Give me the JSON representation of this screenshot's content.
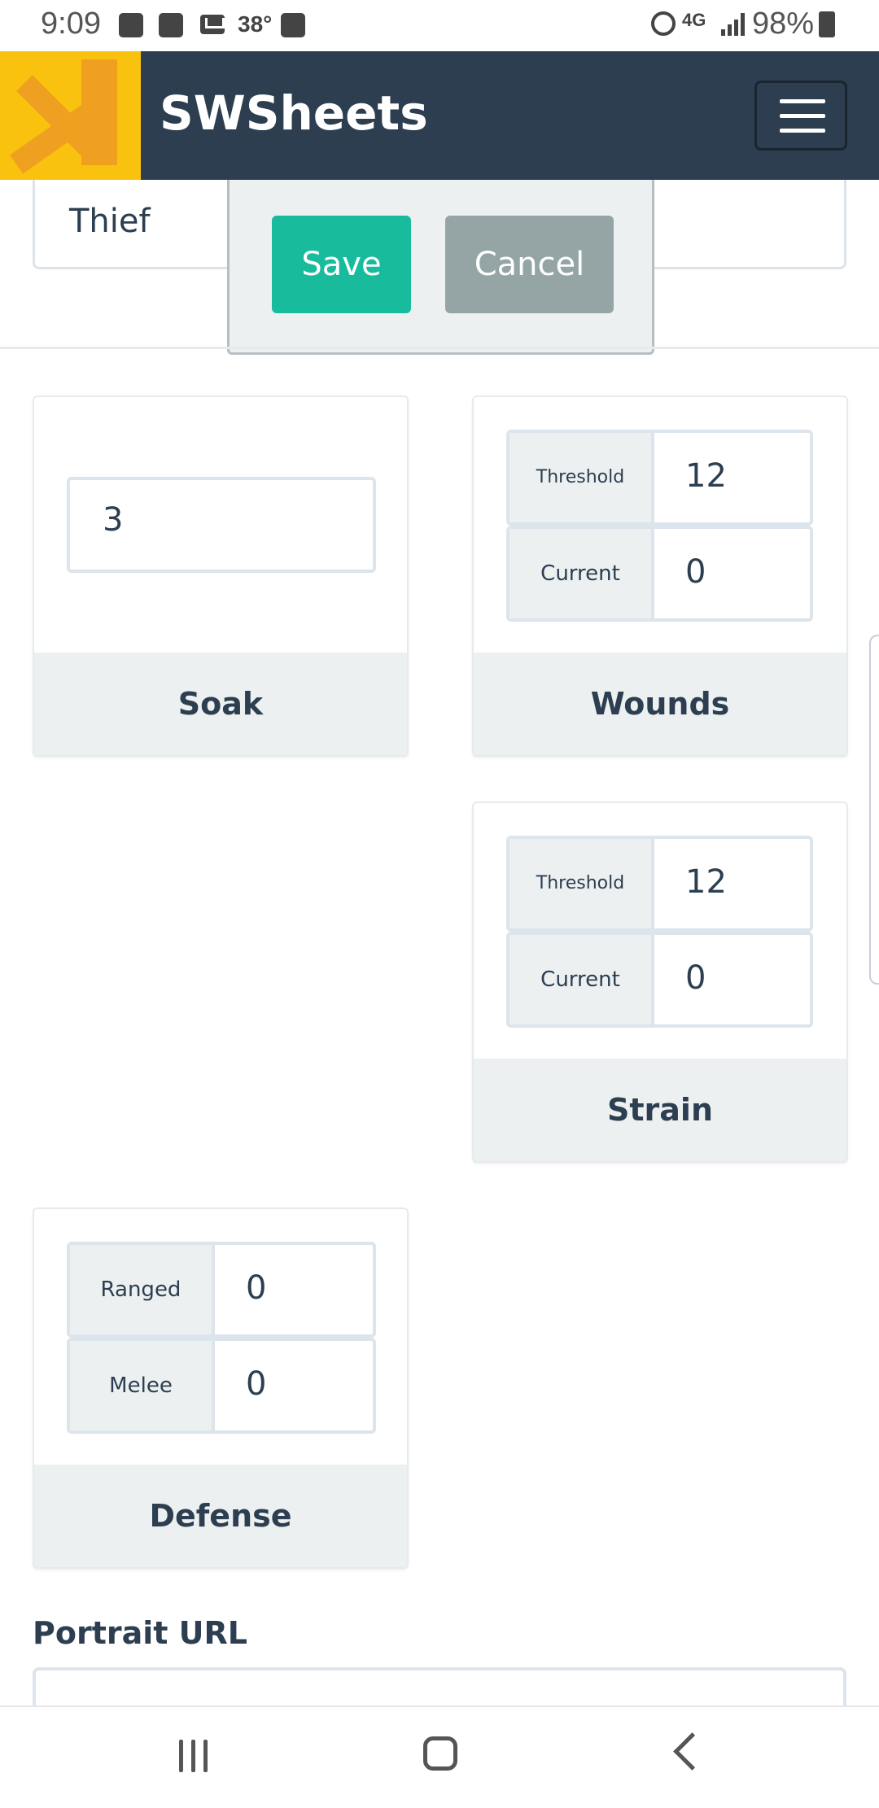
{
  "status_bar": {
    "time": "9:09",
    "temperature": "38°",
    "network": "4G",
    "battery": "98%"
  },
  "navbar": {
    "brand": "SWSheets"
  },
  "character": {
    "class_value": "Thief"
  },
  "popover": {
    "save_label": "Save",
    "cancel_label": "Cancel"
  },
  "soak": {
    "title": "Soak",
    "value": "3"
  },
  "wounds": {
    "title": "Wounds",
    "threshold_label": "Threshold",
    "threshold_value": "12",
    "current_label": "Current",
    "current_value": "0"
  },
  "strain": {
    "title": "Strain",
    "threshold_label": "Threshold",
    "threshold_value": "12",
    "current_label": "Current",
    "current_value": "0"
  },
  "defense": {
    "title": "Defense",
    "ranged_label": "Ranged",
    "ranged_value": "0",
    "melee_label": "Melee",
    "melee_value": "0"
  },
  "portrait": {
    "label": "Portrait URL",
    "value": ""
  },
  "colors": {
    "navbar": "#2c3e50",
    "save": "#18bc9c",
    "cancel": "#95a5a6",
    "logo": "#f9c20f"
  }
}
